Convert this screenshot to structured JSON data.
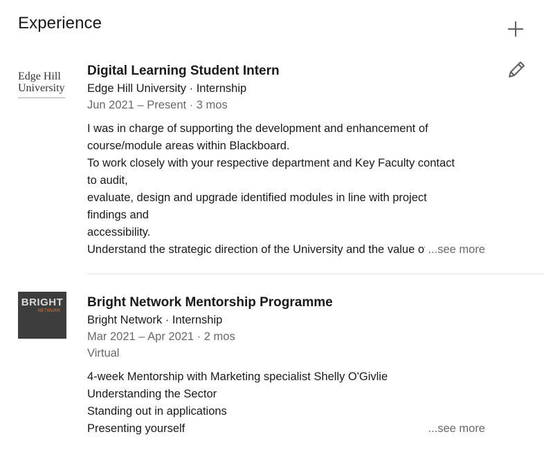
{
  "section": {
    "title": "Experience",
    "add_icon": "plus-icon",
    "edit_icon": "pencil-icon"
  },
  "experiences": [
    {
      "logo": {
        "line1": "Edge Hill",
        "line2": "University"
      },
      "title": "Digital Learning Student Intern",
      "company": "Edge Hill University · Internship",
      "dates": "Jun 2021 – Present · 3 mos",
      "location": "",
      "description": [
        "I was in charge of supporting the development and enhancement of",
        "course/module areas within Blackboard.",
        "To work closely with your respective department and Key Faculty contact",
        "to audit,",
        "evaluate, design and upgrade identified modules in line with project",
        "findings and",
        "accessibility.",
        "Understand the strategic direction of the University and the value of"
      ],
      "see_more": "...see more"
    },
    {
      "logo": {
        "line1": "BRIGHT",
        "line2": "NETWORK",
        "accent": "#e8732a",
        "bg": "#3d3d3d"
      },
      "title": "Bright Network Mentorship Programme",
      "company": "Bright Network · Internship",
      "dates": "Mar 2021 – Apr 2021 · 2 mos",
      "location": "Virtual",
      "description": [
        "4-week Mentorship with Marketing specialist Shelly O'Givlie",
        "Understanding the Sector",
        "Standing out in applications",
        "Presenting yourself"
      ],
      "see_more": "...see more"
    }
  ]
}
